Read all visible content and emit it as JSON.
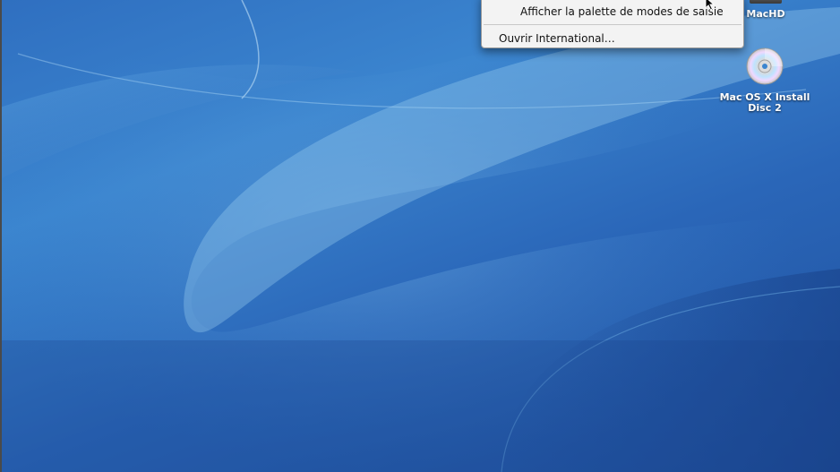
{
  "context_menu": {
    "items": [
      {
        "label": "Afficher la palette de modes de saisie"
      },
      {
        "label": "Ouvrir International…"
      }
    ]
  },
  "desktop_icons": [
    {
      "label": "MacHD",
      "icon": "hard-drive-icon"
    },
    {
      "label": "Mac OS X Install Disc 2",
      "icon": "cd-disc-icon"
    }
  ],
  "colors": {
    "desktop_background": "#2f6fc0",
    "menu_background": "#f3f3f3"
  }
}
